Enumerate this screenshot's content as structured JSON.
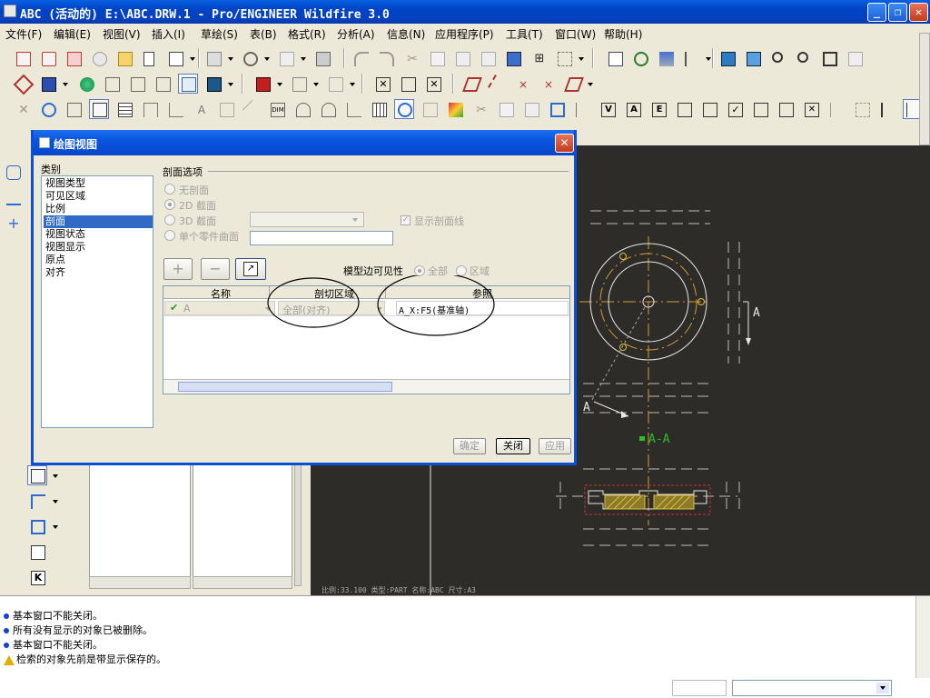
{
  "window": {
    "title": "ABC (活动的) E:\\ABC.DRW.1 - Pro/ENGINEER Wildfire 3.0"
  },
  "menu": [
    "文件(F)",
    "编辑(E)",
    "视图(V)",
    "插入(I)",
    "草绘(S)",
    "表(B)",
    "格式(R)",
    "分析(A)",
    "信息(N)",
    "应用程序(P)",
    "工具(T)",
    "窗口(W)",
    "帮助(H)"
  ],
  "dialog": {
    "title": "绘图视图",
    "category_label": "类别",
    "categories": [
      "视图类型",
      "可见区域",
      "比例",
      "剖面",
      "视图状态",
      "视图显示",
      "原点",
      "对齐"
    ],
    "selected_category": "剖面",
    "section_options_label": "剖面选项",
    "radio_options": [
      "无剖面",
      "2D 截面",
      "3D 截面",
      "单个零件曲面"
    ],
    "show_xsec_label": "显示剖面线",
    "model_edge_label": "模型边可见性",
    "vis_all": "全部",
    "vis_area": "区域",
    "col_name": "名称",
    "col_region": "剖切区域",
    "col_ref": "参照",
    "row": {
      "name": "A",
      "region": "全部(对齐)",
      "ref": "A_X:F5(基准轴)"
    },
    "ok": "确定",
    "close": "关闭",
    "apply": "应用",
    "add_btn": "+",
    "remove_btn": "−"
  },
  "drawing": {
    "label_a_right": "A",
    "label_a_left": "A",
    "section_label": "A-A",
    "status_text": "比例:33.100  类型:PART  名称:ABC  尺寸:A3"
  },
  "messages": [
    "基本窗口不能关闭。",
    "所有没有显示的对象已被删除。",
    "基本窗口不能关闭。",
    "检索的对象先前是带显示保存的。"
  ],
  "colors": {
    "accent": "#0a4fd6",
    "canvas": "#2d2c28",
    "selection": "#316ac5"
  }
}
